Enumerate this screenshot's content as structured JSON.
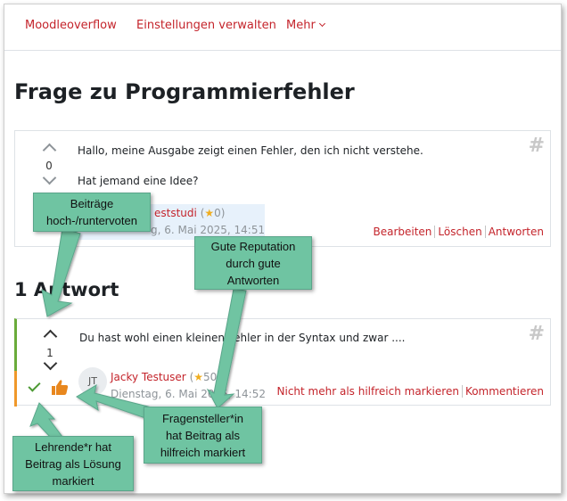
{
  "nav": {
    "items": [
      "Moodleoverflow",
      "Einstellungen verwalten",
      "Mehr"
    ]
  },
  "title": "Frage zu Programmierfehler",
  "question": {
    "votes": "0",
    "lines": [
      "Hallo, meine Ausgabe zeigt einen Fehler, den ich nicht verstehe.",
      "Hat jemand eine Idee?"
    ],
    "author": "eststudi",
    "reputation": "0",
    "date": "g, 6. Mai 2025, 14:51",
    "actions": [
      "Bearbeiten",
      "Löschen",
      "Antworten"
    ]
  },
  "answers_heading": "1 Antwort",
  "answer": {
    "votes": "1",
    "text": "Du hast wohl einen kleinen Fehler in der Syntax und zwar ....",
    "avatar_initials": "JT",
    "author": "Jacky Testuser",
    "reputation": "50",
    "date": "Dienstag, 6. Mai 2025, 14:52",
    "actions": [
      "Nicht mehr als hilfreich markieren",
      "Kommentieren"
    ]
  },
  "callouts": {
    "votes": "Beiträge\nhoch-/runtervoten",
    "reputation": "Gute Reputation\ndurch gute\nAntworten",
    "helpful": "Fragensteller*in\nhat Beitrag als\nhilfreich markiert",
    "solution": "Lehrende*r hat\nBeitrag als Lösung\nmarkiert"
  },
  "icons": {
    "hash": "hash-icon",
    "star": "star-icon",
    "check": "solution-check-icon",
    "thumb": "thumbs-up-icon"
  },
  "colors": {
    "link": "#c4242b",
    "callout": "#6fc4a2",
    "solution": "#6aab3a",
    "helpful": "#f0982a"
  }
}
